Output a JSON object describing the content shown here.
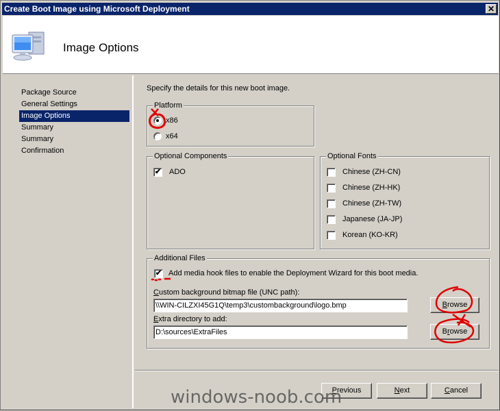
{
  "window": {
    "title": "Create Boot Image using Microsoft Deployment",
    "close_label": "✕"
  },
  "header": {
    "title": "Image Options",
    "icon": "computer-icon"
  },
  "nav": {
    "items": [
      {
        "label": "Package Source",
        "active": false
      },
      {
        "label": "General Settings",
        "active": false
      },
      {
        "label": "Image Options",
        "active": true
      },
      {
        "label": "Summary",
        "active": false
      },
      {
        "label": "Summary",
        "active": false
      },
      {
        "label": "Confirmation",
        "active": false
      }
    ]
  },
  "content": {
    "intro": "Specify the details for this new boot image.",
    "platform": {
      "legend": "Platform",
      "options": [
        {
          "label": "x86",
          "selected": true
        },
        {
          "label": "x64",
          "selected": false
        }
      ]
    },
    "optional_components": {
      "legend": "Optional Components",
      "items": [
        {
          "label": "ADO",
          "checked": true
        }
      ]
    },
    "optional_fonts": {
      "legend": "Optional Fonts",
      "items": [
        {
          "label": "Chinese (ZH-CN)",
          "checked": false
        },
        {
          "label": "Chinese (ZH-HK)",
          "checked": false
        },
        {
          "label": "Chinese (ZH-TW)",
          "checked": false
        },
        {
          "label": "Japanese (JA-JP)",
          "checked": false
        },
        {
          "label": "Korean (KO-KR)",
          "checked": false
        }
      ]
    },
    "additional_files": {
      "legend": "Additional Files",
      "media_hook": {
        "label": "Add media hook files to enable the Deployment Wizard for this boot media.",
        "checked": true
      },
      "background": {
        "label_prefix": "C",
        "label_rest": "ustom background bitmap file (UNC path):",
        "value": "\\\\WIN-CILZXI45G1Q\\temp3\\custombackground\\logo.bmp",
        "browse_prefix": "B",
        "browse_rest": "rowse"
      },
      "extra_dir": {
        "label_prefix": "E",
        "label_rest": "xtra directory to add:",
        "value": "D:\\sources\\ExtraFiles",
        "browse_prefix": "B",
        "browse_mid": "r",
        "browse_rest": "owse"
      }
    }
  },
  "footer": {
    "previous": {
      "prefix": "P",
      "rest": "revious"
    },
    "next": {
      "prefix": "N",
      "rest": "ext"
    },
    "cancel": {
      "prefix": "C",
      "rest": "ancel"
    }
  },
  "watermark": "windows-noob.com",
  "colors": {
    "titlebar": "#0a246a",
    "selection": "#0a246a",
    "face": "#d4d0c8",
    "annotation": "#e00000"
  }
}
